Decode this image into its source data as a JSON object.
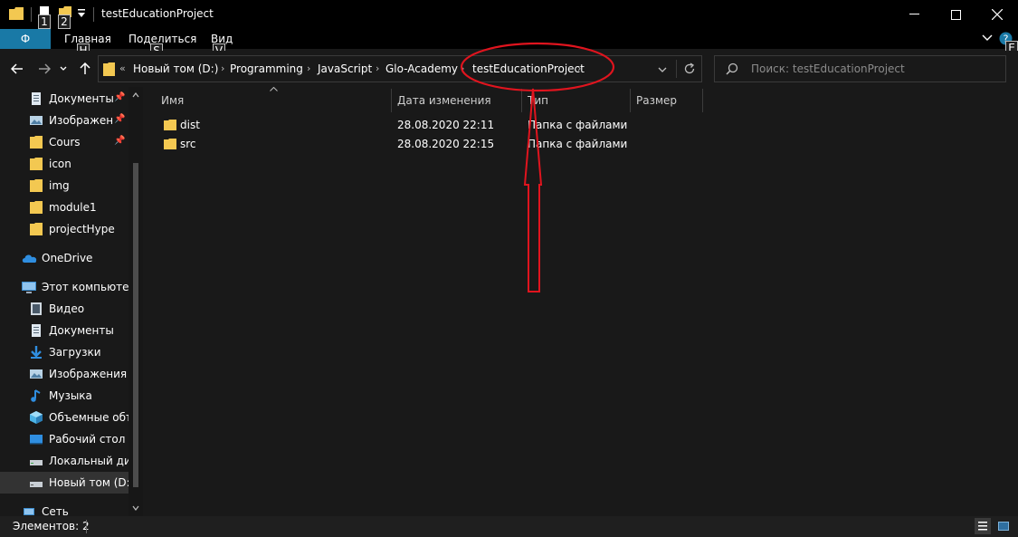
{
  "window": {
    "title": "testEducationProject",
    "quick_access_keytips": [
      "1",
      "2"
    ],
    "minimize_label": "—",
    "maximize_label": "☐",
    "close_label": "✕"
  },
  "ribbon": {
    "file_tab": "Ф",
    "tabs": [
      {
        "label": "Главная",
        "keytip": "H"
      },
      {
        "label": "Поделиться",
        "keytip": "S"
      },
      {
        "label": "Вид",
        "keytip": "V"
      }
    ],
    "help_keytip": "E"
  },
  "address": {
    "overflow": "«",
    "crumbs": [
      "Новый том (D:)",
      "Programming",
      "JavaScript",
      "Glo-Academy",
      "testEducationProject"
    ]
  },
  "search": {
    "placeholder": "Поиск: testEducationProject"
  },
  "nav": {
    "quick_access": [
      {
        "label": "Документы",
        "icon": "documents-icon",
        "pinned": true
      },
      {
        "label": "Изображени",
        "icon": "pictures-icon",
        "pinned": true
      },
      {
        "label": "Cours",
        "icon": "folder-icon",
        "pinned": true
      },
      {
        "label": "icon",
        "icon": "folder-icon",
        "pinned": false
      },
      {
        "label": "img",
        "icon": "folder-icon",
        "pinned": false
      },
      {
        "label": "module1",
        "icon": "folder-icon",
        "pinned": false
      },
      {
        "label": "projectHype",
        "icon": "folder-icon",
        "pinned": false
      }
    ],
    "onedrive": "OneDrive",
    "this_pc": "Этот компьютер",
    "pc_items": [
      {
        "label": "Видео",
        "icon": "video-icon"
      },
      {
        "label": "Документы",
        "icon": "documents-icon"
      },
      {
        "label": "Загрузки",
        "icon": "downloads-icon"
      },
      {
        "label": "Изображения",
        "icon": "pictures-icon"
      },
      {
        "label": "Музыка",
        "icon": "music-icon"
      },
      {
        "label": "Объемные объ",
        "icon": "3d-objects-icon"
      },
      {
        "label": "Рабочий стол",
        "icon": "desktop-icon"
      },
      {
        "label": "Локальный дис",
        "icon": "drive-icon"
      },
      {
        "label": "Новый том (D:)",
        "icon": "drive-icon",
        "selected": true
      }
    ],
    "network": "Сеть"
  },
  "columns": {
    "name": "Имя",
    "date": "Дата изменения",
    "type": "Тип",
    "size": "Размер"
  },
  "files": [
    {
      "name": "dist",
      "date": "28.08.2020 22:11",
      "type": "Папка с файлами"
    },
    {
      "name": "src",
      "date": "28.08.2020 22:15",
      "type": "Папка с файлами"
    }
  ],
  "status": {
    "items_count": "Элементов: 2"
  },
  "colors": {
    "accent": "#1979a6",
    "folder": "#f3c851",
    "annotation": "#e0141e"
  }
}
